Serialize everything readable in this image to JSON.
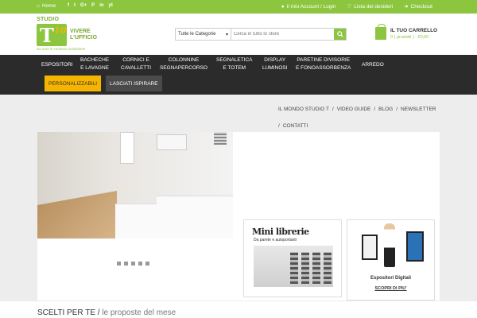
{
  "topbar": {
    "home": "Home",
    "social": [
      "f",
      "t",
      "G+",
      "P",
      "in",
      "yt"
    ],
    "account": "Il mio Account / Login",
    "wishlist": "Lista dei desideri",
    "checkout": "Checkout"
  },
  "logo": {
    "studio": "STUDIO",
    "letter": "T",
    "number": "10",
    "subtitle": "Da anni in continua evoluzione",
    "tagline_1": "VIVERE",
    "tagline_2": "L'UFFICIO"
  },
  "search": {
    "category": "Tutte le Categorie",
    "placeholder": "Cerca in tutto lo store"
  },
  "cart": {
    "title": "IL TUO CARRELLO",
    "info": "0 ( prodotti ) - €0,00"
  },
  "nav": {
    "items": [
      {
        "line1": "ESPOSITORI",
        "line2": ""
      },
      {
        "line1": "BACHECHE",
        "line2": "E LAVAGNE"
      },
      {
        "line1": "CORNICI E",
        "line2": "CAVALLETTI"
      },
      {
        "line1": "COLONNINE",
        "line2": "SEGNAPERCORSO"
      },
      {
        "line1": "SEGNALETICA",
        "line2": "E TOTEM"
      },
      {
        "line1": "DISPLAY",
        "line2": "LUMINOSI"
      },
      {
        "line1": "PARETINE DIVISORIE",
        "line2": "E FONOASSORBENZA"
      },
      {
        "line1": "ARREDO",
        "line2": ""
      }
    ],
    "chip_personalizzabili": "PERSONALIZZABILI",
    "chip_ispirare": "LASCIATI ISPIRARE"
  },
  "banner": {
    "links": [
      "IL MONDO STUDIO T",
      "VIDEO GUIDE",
      "BLOG",
      "NEWSLETTER",
      "CONTATTI"
    ]
  },
  "cards": {
    "mini_title": "Mini librerie",
    "mini_sub": "Da parete e autoportanti",
    "digi_label": "Espositori Digitali",
    "digi_cta": "SCOPRI DI PIU'"
  },
  "section": {
    "title": "SCELTI PER TE",
    "subtitle": "le proposte del mese"
  },
  "colors": {
    "brand_green": "#8cc63f",
    "nav_dark": "#2b2b2b",
    "accent_yellow": "#f5b400"
  }
}
